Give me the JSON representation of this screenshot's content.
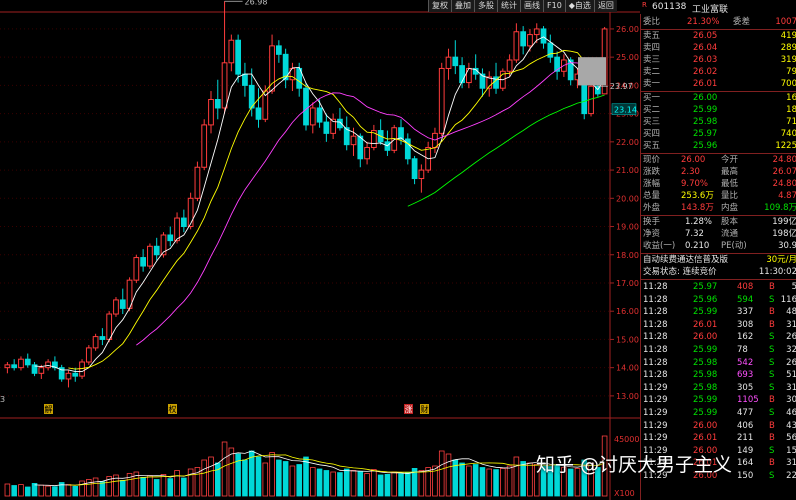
{
  "toolbar": [
    "复权",
    "叠加",
    "多股",
    "统计",
    "画线",
    "F10",
    "◆自选",
    "返回"
  ],
  "stock": {
    "code": "601138",
    "name": "工业富联",
    "marker": "R"
  },
  "weibi": {
    "label1": "委比",
    "v1": "21.30%",
    "label2": "委差",
    "v2": "1007"
  },
  "asks": [
    {
      "label": "卖五",
      "price": "26.05",
      "vol": "419"
    },
    {
      "label": "卖四",
      "price": "26.04",
      "vol": "289"
    },
    {
      "label": "卖三",
      "price": "26.03",
      "vol": "319"
    },
    {
      "label": "卖二",
      "price": "26.02",
      "vol": "79"
    },
    {
      "label": "卖一",
      "price": "26.01",
      "vol": "700"
    }
  ],
  "bids": [
    {
      "label": "买一",
      "price": "26.00",
      "vol": "16"
    },
    {
      "label": "买二",
      "price": "25.99",
      "vol": "18"
    },
    {
      "label": "买三",
      "price": "25.98",
      "vol": "71"
    },
    {
      "label": "买四",
      "price": "25.97",
      "vol": "740"
    },
    {
      "label": "买五",
      "price": "25.96",
      "vol": "1225"
    }
  ],
  "stats": [
    {
      "l1": "现价",
      "v1": "26.00",
      "c1": "red",
      "l2": "今开",
      "v2": "24.80",
      "c2": "red"
    },
    {
      "l1": "涨跌",
      "v1": "2.30",
      "c1": "red",
      "l2": "最高",
      "v2": "26.07",
      "c2": "red"
    },
    {
      "l1": "涨幅",
      "v1": "9.70%",
      "c1": "red",
      "l2": "最低",
      "v2": "24.80",
      "c2": "red"
    },
    {
      "l1": "总量",
      "v1": "253.6万",
      "c1": "yellow",
      "l2": "量比",
      "v2": "4.87",
      "c2": "red"
    },
    {
      "l1": "外盘",
      "v1": "143.8万",
      "c1": "red",
      "l2": "内盘",
      "v2": "109.8万",
      "c2": "green"
    }
  ],
  "stats2": [
    {
      "l1": "换手",
      "v1": "1.28%",
      "l2": "股本",
      "v2": "199亿"
    },
    {
      "l1": "净资",
      "v1": "7.32",
      "l2": "流通",
      "v2": "198亿"
    },
    {
      "l1": "收益(一)",
      "v1": "0.210",
      "l2": "PE(动)",
      "v2": "30.9"
    }
  ],
  "promo": {
    "text": "自动续费通达信普及版",
    "price": "30元/月"
  },
  "trade_status": {
    "label": "交易状态: 连续竞价",
    "time": "11:30:02"
  },
  "ticks": [
    {
      "t": "11:28",
      "p": "25.97",
      "v": "408",
      "s": "B",
      "n": "5",
      "pc": "green",
      "vc": "red"
    },
    {
      "t": "11:28",
      "p": "25.96",
      "v": "594",
      "s": "S",
      "n": "116",
      "pc": "green",
      "vc": "green"
    },
    {
      "t": "11:28",
      "p": "25.99",
      "v": "337",
      "s": "B",
      "n": "48",
      "pc": "green",
      "vc": "white"
    },
    {
      "t": "11:28",
      "p": "26.01",
      "v": "308",
      "s": "B",
      "n": "31",
      "pc": "red",
      "vc": "white"
    },
    {
      "t": "11:28",
      "p": "26.00",
      "v": "162",
      "s": "S",
      "n": "26",
      "pc": "red",
      "vc": "white"
    },
    {
      "t": "11:28",
      "p": "25.99",
      "v": "78",
      "s": "S",
      "n": "32",
      "pc": "green",
      "vc": "white"
    },
    {
      "t": "11:28",
      "p": "25.98",
      "v": "542",
      "s": "S",
      "n": "26",
      "pc": "green",
      "vc": "magenta"
    },
    {
      "t": "11:28",
      "p": "25.98",
      "v": "693",
      "s": "S",
      "n": "51",
      "pc": "green",
      "vc": "magenta"
    },
    {
      "t": "11:29",
      "p": "25.98",
      "v": "305",
      "s": "S",
      "n": "31",
      "pc": "green",
      "vc": "white"
    },
    {
      "t": "11:29",
      "p": "25.99",
      "v": "1105",
      "s": "B",
      "n": "30",
      "pc": "green",
      "vc": "magenta"
    },
    {
      "t": "11:29",
      "p": "25.99",
      "v": "477",
      "s": "S",
      "n": "46",
      "pc": "green",
      "vc": "white"
    },
    {
      "t": "11:29",
      "p": "26.00",
      "v": "406",
      "s": "B",
      "n": "43",
      "pc": "red",
      "vc": "white"
    },
    {
      "t": "11:29",
      "p": "26.01",
      "v": "211",
      "s": "B",
      "n": "56",
      "pc": "red",
      "vc": "white"
    },
    {
      "t": "11:29",
      "p": "26.00",
      "v": "149",
      "s": "S",
      "n": "15",
      "pc": "red",
      "vc": "white"
    },
    {
      "t": "11:29",
      "p": "26.01",
      "v": "164",
      "s": "B",
      "n": "31",
      "pc": "red",
      "vc": "white"
    },
    {
      "t": "11:29",
      "p": "26.00",
      "v": "150",
      "s": "S",
      "n": "22",
      "pc": "red",
      "vc": "white"
    }
  ],
  "watermark": "知乎 @讨厌大男子主义",
  "chart_labels": {
    "high": "26.98",
    "low_marker": "23.97",
    "left_label": "3",
    "event1": "解",
    "event2": "权",
    "event3": "涨",
    "event4": "财",
    "current": "23.14",
    "vol_axis_top": "45000",
    "vol_axis_unit": "X100"
  },
  "chart_data": {
    "type": "candlestick",
    "price_axis": {
      "ticks": [
        26.0,
        25.0,
        24.0,
        23.0,
        22.0,
        21.0,
        20.0,
        19.0,
        18.0,
        17.0,
        16.0,
        15.0,
        14.0,
        13.0
      ],
      "range": [
        12.5,
        26.6
      ]
    },
    "candles": [
      [
        14.0,
        14.2,
        13.8,
        14.1
      ],
      [
        14.1,
        14.3,
        13.9,
        14.0
      ],
      [
        14.0,
        14.4,
        13.9,
        14.3
      ],
      [
        14.3,
        14.5,
        14.0,
        14.1
      ],
      [
        14.1,
        14.2,
        13.7,
        13.8
      ],
      [
        13.8,
        14.1,
        13.6,
        14.0
      ],
      [
        14.0,
        14.3,
        13.9,
        14.2
      ],
      [
        14.2,
        14.4,
        13.9,
        14.0
      ],
      [
        14.0,
        14.1,
        13.5,
        13.6
      ],
      [
        13.6,
        13.9,
        13.3,
        13.8
      ],
      [
        13.8,
        14.0,
        13.5,
        13.7
      ],
      [
        13.7,
        14.3,
        13.6,
        14.2
      ],
      [
        14.2,
        14.8,
        14.1,
        14.7
      ],
      [
        14.7,
        15.2,
        14.6,
        15.1
      ],
      [
        15.1,
        15.4,
        14.8,
        15.0
      ],
      [
        15.0,
        16.0,
        14.9,
        15.9
      ],
      [
        15.9,
        16.5,
        15.8,
        16.4
      ],
      [
        16.4,
        16.8,
        15.9,
        16.1
      ],
      [
        16.1,
        17.2,
        16.0,
        17.1
      ],
      [
        17.1,
        18.0,
        17.0,
        17.9
      ],
      [
        17.9,
        18.2,
        17.4,
        17.6
      ],
      [
        17.6,
        18.4,
        17.5,
        18.3
      ],
      [
        18.3,
        18.6,
        17.8,
        18.0
      ],
      [
        18.0,
        18.8,
        17.9,
        18.7
      ],
      [
        18.7,
        19.0,
        18.3,
        18.5
      ],
      [
        18.5,
        19.5,
        18.4,
        19.3
      ],
      [
        19.3,
        19.6,
        18.8,
        19.0
      ],
      [
        19.0,
        20.2,
        18.9,
        20.0
      ],
      [
        20.0,
        21.3,
        19.9,
        21.1
      ],
      [
        21.1,
        22.8,
        21.0,
        22.6
      ],
      [
        22.6,
        23.8,
        22.3,
        23.5
      ],
      [
        23.5,
        24.2,
        22.8,
        23.2
      ],
      [
        23.2,
        26.98,
        23.0,
        24.8
      ],
      [
        24.8,
        25.8,
        24.5,
        25.6
      ],
      [
        25.6,
        25.8,
        24.1,
        24.4
      ],
      [
        24.4,
        24.8,
        23.6,
        24.0
      ],
      [
        24.0,
        24.6,
        22.9,
        23.2
      ],
      [
        23.2,
        23.9,
        22.5,
        22.8
      ],
      [
        22.8,
        24.0,
        22.7,
        23.8
      ],
      [
        23.8,
        25.8,
        23.7,
        25.4
      ],
      [
        25.4,
        25.6,
        24.8,
        25.1
      ],
      [
        25.1,
        25.3,
        23.9,
        24.2
      ],
      [
        24.2,
        24.8,
        23.8,
        24.6
      ],
      [
        24.6,
        24.8,
        23.6,
        23.9
      ],
      [
        23.9,
        24.1,
        22.4,
        22.6
      ],
      [
        22.6,
        23.4,
        22.3,
        23.2
      ],
      [
        23.2,
        23.5,
        22.5,
        22.7
      ],
      [
        22.7,
        23.0,
        22.0,
        22.3
      ],
      [
        22.3,
        23.0,
        22.1,
        22.8
      ],
      [
        22.8,
        23.2,
        22.4,
        22.5
      ],
      [
        22.5,
        22.9,
        21.7,
        21.9
      ],
      [
        21.9,
        22.5,
        21.5,
        22.2
      ],
      [
        22.2,
        22.3,
        21.1,
        21.4
      ],
      [
        21.4,
        22.0,
        21.2,
        21.8
      ],
      [
        21.8,
        22.6,
        21.7,
        22.4
      ],
      [
        22.4,
        22.8,
        21.9,
        22.0
      ],
      [
        22.0,
        22.4,
        21.5,
        21.7
      ],
      [
        21.7,
        22.6,
        21.6,
        22.5
      ],
      [
        22.5,
        22.8,
        21.9,
        22.1
      ],
      [
        22.1,
        22.3,
        21.2,
        21.4
      ],
      [
        21.4,
        21.5,
        20.5,
        20.7
      ],
      [
        20.7,
        21.2,
        20.2,
        21.0
      ],
      [
        21.0,
        22.0,
        20.9,
        21.8
      ],
      [
        21.8,
        22.5,
        21.6,
        22.3
      ],
      [
        22.3,
        24.8,
        22.2,
        24.6
      ],
      [
        24.6,
        25.3,
        24.2,
        25.0
      ],
      [
        25.0,
        25.6,
        24.4,
        24.7
      ],
      [
        24.7,
        25.0,
        23.9,
        24.1
      ],
      [
        24.1,
        24.8,
        23.9,
        24.6
      ],
      [
        24.6,
        25.1,
        24.2,
        24.4
      ],
      [
        24.4,
        24.6,
        23.6,
        23.9
      ],
      [
        23.9,
        24.5,
        23.6,
        24.3
      ],
      [
        24.3,
        24.8,
        23.7,
        23.9
      ],
      [
        23.9,
        24.6,
        23.8,
        24.5
      ],
      [
        24.5,
        25.1,
        24.3,
        24.9
      ],
      [
        24.9,
        26.2,
        24.8,
        25.9
      ],
      [
        25.9,
        26.1,
        25.1,
        25.4
      ],
      [
        25.4,
        26.0,
        25.2,
        25.8
      ],
      [
        25.8,
        26.2,
        25.5,
        26.0
      ],
      [
        26.0,
        26.1,
        25.3,
        25.5
      ],
      [
        25.5,
        25.8,
        24.8,
        25.0
      ],
      [
        25.0,
        25.2,
        24.2,
        24.5
      ],
      [
        24.5,
        25.1,
        24.3,
        24.9
      ],
      [
        24.9,
        25.0,
        24.0,
        24.2
      ],
      [
        24.2,
        24.6,
        23.9,
        24.4
      ],
      [
        24.4,
        24.6,
        22.8,
        23.0
      ],
      [
        23.0,
        24.1,
        22.9,
        23.97
      ],
      [
        23.97,
        24.2,
        23.6,
        23.7
      ],
      [
        23.7,
        26.07,
        23.7,
        26.0
      ]
    ],
    "volumes": [
      40,
      35,
      38,
      30,
      42,
      36,
      33,
      31,
      45,
      38,
      32,
      50,
      55,
      60,
      48,
      65,
      70,
      52,
      75,
      80,
      62,
      68,
      55,
      72,
      58,
      85,
      60,
      90,
      95,
      120,
      130,
      110,
      180,
      160,
      140,
      120,
      150,
      130,
      110,
      145,
      120,
      115,
      100,
      105,
      130,
      95,
      90,
      85,
      80,
      78,
      90,
      85,
      82,
      75,
      88,
      70,
      72,
      80,
      74,
      78,
      92,
      85,
      95,
      100,
      150,
      140,
      120,
      110,
      100,
      105,
      95,
      90,
      88,
      92,
      100,
      130,
      115,
      110,
      105,
      100,
      98,
      105,
      95,
      90,
      92,
      120,
      110,
      95,
      200
    ],
    "ma_colors": {
      "ma5": "#ffffff",
      "ma10": "#ffff00",
      "ma20": "#ff40ff",
      "ma60": "#00ff00"
    }
  }
}
